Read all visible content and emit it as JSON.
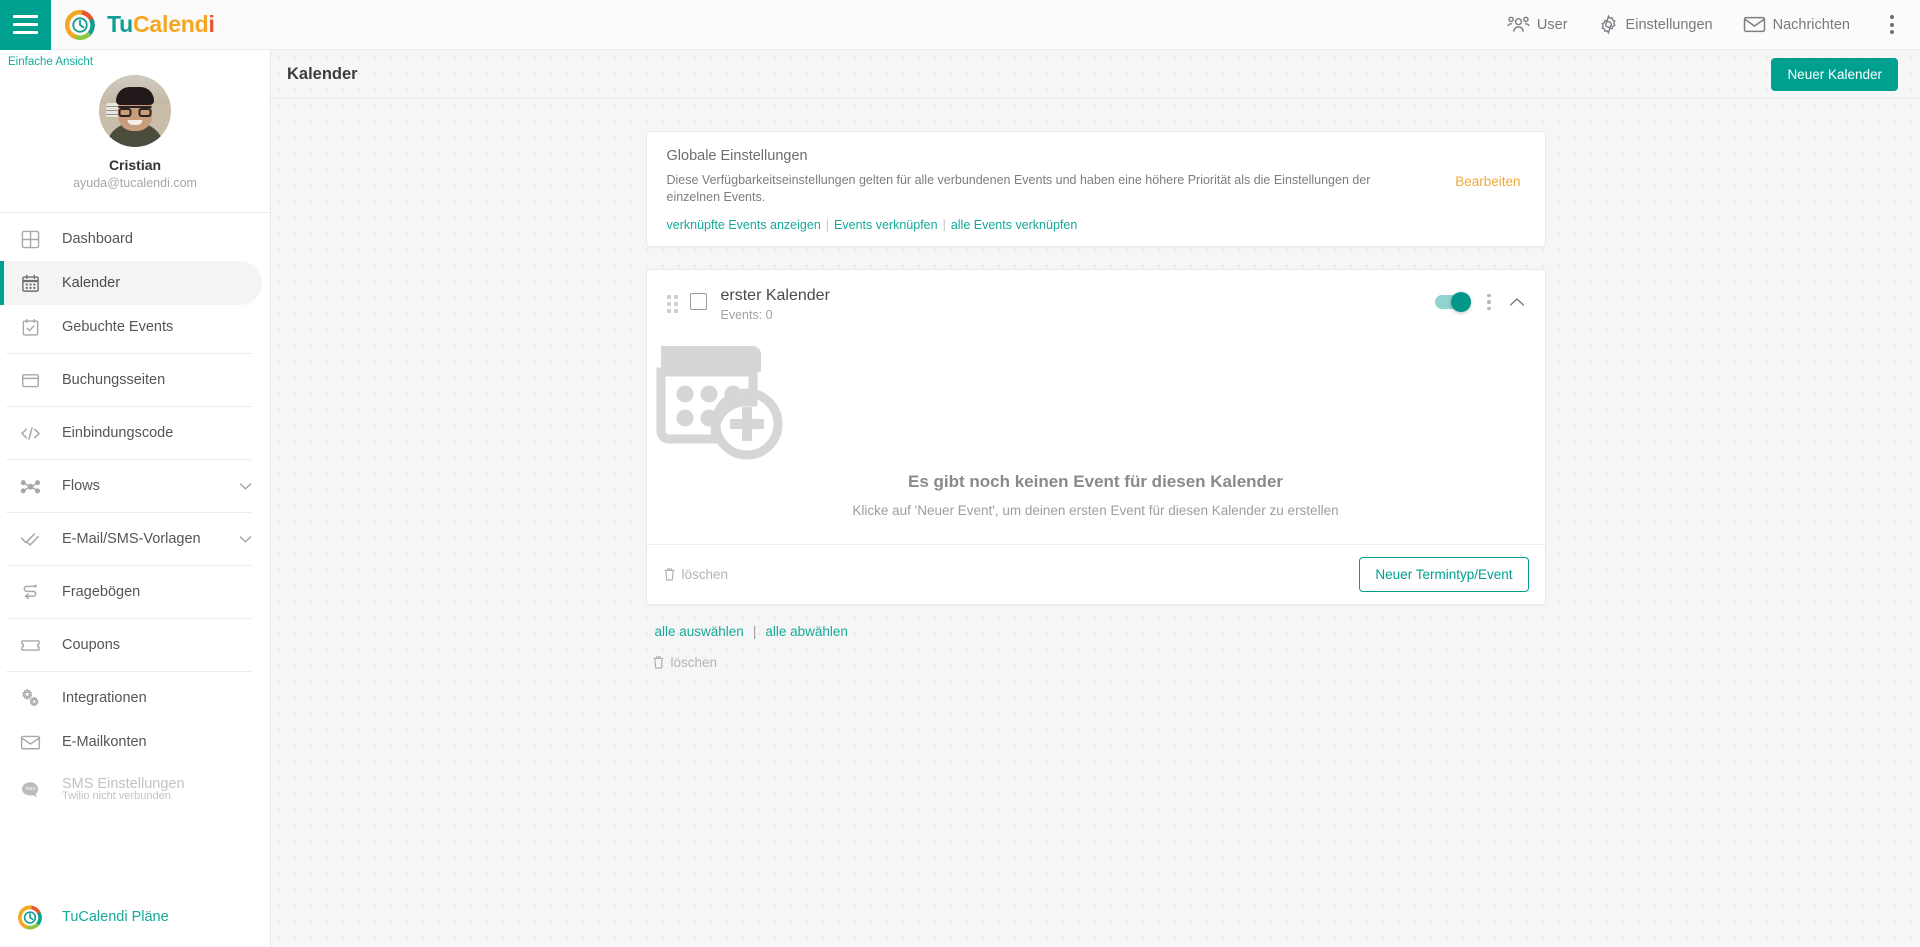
{
  "topbar": {
    "menu_icon": "hamburger-icon",
    "brand": {
      "part1": "Tu",
      "part2": "Calend",
      "part3": "i"
    },
    "items": [
      {
        "icon": "users-icon",
        "label": "User"
      },
      {
        "icon": "gear-icon",
        "label": "Einstellungen"
      },
      {
        "icon": "envelope-icon",
        "label": "Nachrichten"
      }
    ],
    "overflow_icon": "kebab-menu-icon"
  },
  "sidebar": {
    "simple_view": "Einfache Ansicht",
    "profile": {
      "name": "Cristian",
      "email": "ayuda@tucalendi.com"
    },
    "items": [
      {
        "icon": "dashboard-grid-icon",
        "label": "Dashboard"
      },
      {
        "icon": "calendar-icon",
        "label": "Kalender"
      },
      {
        "icon": "calendar-check-icon",
        "label": "Gebuchte Events"
      },
      {
        "icon": "booking-page-icon",
        "label": "Buchungsseiten"
      },
      {
        "icon": "code-icon",
        "label": "Einbindungscode"
      },
      {
        "icon": "flows-icon",
        "label": "Flows"
      },
      {
        "icon": "double-check-icon",
        "label": "E-Mail/SMS-Vorlagen"
      },
      {
        "icon": "questionnaire-icon",
        "label": "Fragebögen"
      },
      {
        "icon": "coupon-icon",
        "label": "Coupons"
      },
      {
        "icon": "integrations-gears-icon",
        "label": "Integrationen"
      },
      {
        "icon": "mail-icon",
        "label": "E-Mailkonten"
      },
      {
        "icon": "sms-bubble-icon",
        "label": "SMS Einstellungen",
        "sublabel": "Twilio nicht verbunden"
      }
    ],
    "plans": {
      "icon": "tucalendi-logo-icon",
      "label": "TuCalendi Pläne"
    }
  },
  "page": {
    "title": "Kalender",
    "new_calendar_button": "Neuer Kalender"
  },
  "global_settings": {
    "title": "Globale Einstellungen",
    "description": "Diese Verfügbarkeitseinstellungen gelten für alle verbundenen Events und haben eine höhere Priorität als die Einstellungen der einzelnen Events.",
    "edit_label": "Bearbeiten",
    "links": [
      "verknüpfte Events anzeigen",
      "Events verknüpfen",
      "alle Events verknüpfen"
    ],
    "separator": "|"
  },
  "calendar_card": {
    "name": "erster Kalender",
    "events_count": "Events: 0",
    "toggle_state": "on",
    "empty": {
      "title": "Es gibt noch keinen Event für diesen Kalender",
      "subtitle": "Klicke auf 'Neuer Event', um deinen ersten Event für diesen Kalender zu erstellen",
      "icon": "calendar-add-placeholder-icon"
    },
    "delete_label": "löschen",
    "new_event_button": "Neuer Termintyp/Event"
  },
  "bulk": {
    "select_all": "alle auswählen",
    "deselect_all": "alle abwählen",
    "separator": "|",
    "delete_label": "löschen"
  },
  "colors": {
    "brand_teal": "#00a091",
    "link_teal": "#16a99a",
    "accent_orange": "#f0a93a",
    "logo_orange": "#e8552d",
    "logo_yellow": "#f5a623",
    "logo_green": "#8dc63f"
  }
}
